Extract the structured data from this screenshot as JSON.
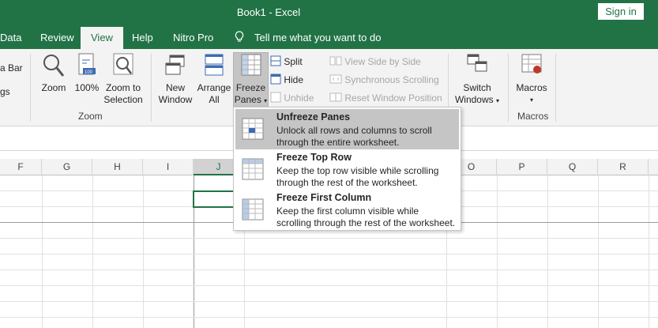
{
  "window": {
    "title": "Book1  -  Excel",
    "signin": "Sign in"
  },
  "tabs": [
    "Data",
    "Review",
    "View",
    "Help",
    "Nitro Pro"
  ],
  "tellme": "Tell me what you want to do",
  "ribbon": {
    "cut_left_top": "a Bar",
    "cut_left_bottom": "gs",
    "zoom": "Zoom",
    "zoom100": "100%",
    "zoom_sel_1": "Zoom to",
    "zoom_sel_2": "Selection",
    "zoom_group": "Zoom",
    "new_window_1": "New",
    "new_window_2": "Window",
    "arrange_1": "Arrange",
    "arrange_2": "All",
    "freeze_1": "Freeze",
    "freeze_2": "Panes",
    "split": "Split",
    "hide": "Hide",
    "unhide": "Unhide",
    "side_by_side": "View Side by Side",
    "sync_scroll": "Synchronous Scrolling",
    "reset_pos": "Reset Window Position",
    "switch_1": "Switch",
    "switch_2": "Windows",
    "macros": "Macros",
    "macros_group": "Macros"
  },
  "columns": [
    "F",
    "G",
    "H",
    "I",
    "J",
    "O",
    "P",
    "Q",
    "R"
  ],
  "freeze_menu": [
    {
      "title": "Unfreeze Panes",
      "desc1": "Unlock all rows and columns to scroll",
      "desc2": "through the entire worksheet."
    },
    {
      "title": "Freeze Top Row",
      "desc1": "Keep the top row visible while scrolling",
      "desc2": "through the rest of the worksheet."
    },
    {
      "title": "Freeze First Column",
      "desc1": "Keep the first column visible while",
      "desc2": "scrolling through the rest of the worksheet."
    }
  ],
  "colors": {
    "accent": "#217346",
    "highlight": "#c5c5c5"
  }
}
